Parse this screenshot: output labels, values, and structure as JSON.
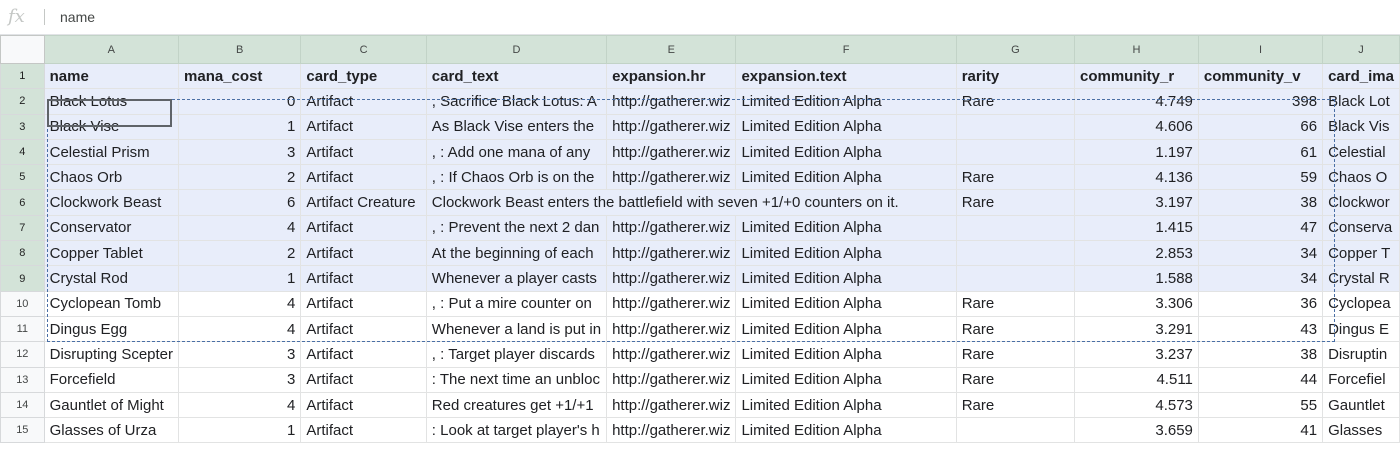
{
  "formula_bar": {
    "icon": "fx",
    "value": "name"
  },
  "columns": [
    "A",
    "B",
    "C",
    "D",
    "E",
    "F",
    "G",
    "H",
    "I",
    "J"
  ],
  "rows": [
    {
      "num": "1",
      "cells": [
        "name",
        "mana_cost",
        "card_type",
        "card_text",
        "expansion.hr",
        "expansion.text",
        "rarity",
        "community_r",
        "community_v",
        "card_ima"
      ]
    },
    {
      "num": "2",
      "cells": [
        "Black Lotus",
        "0",
        "Artifact",
        ", Sacrifice Black Lotus: A",
        "http://gatherer.wiz",
        "Limited Edition Alpha",
        "Rare",
        "4.749",
        "398",
        "Black Lot"
      ]
    },
    {
      "num": "3",
      "cells": [
        "Black Vise",
        "1",
        "Artifact",
        "As Black Vise enters the",
        "http://gatherer.wiz",
        "Limited Edition Alpha",
        "",
        "4.606",
        "66",
        "Black Vis"
      ]
    },
    {
      "num": "4",
      "cells": [
        "Celestial Prism",
        "3",
        "Artifact",
        ", : Add one mana of any",
        "http://gatherer.wiz",
        "Limited Edition Alpha",
        "",
        "1.197",
        "61",
        "Celestial"
      ]
    },
    {
      "num": "5",
      "cells": [
        "Chaos Orb",
        "2",
        "Artifact",
        ", : If Chaos Orb is on the",
        "http://gatherer.wiz",
        "Limited Edition Alpha",
        "Rare",
        "4.136",
        "59",
        "Chaos O"
      ]
    },
    {
      "num": "6",
      "cells": [
        "Clockwork Beast",
        "6",
        "Artifact Creature",
        "Clockwork Beast enters the battlefield with seven +1/+0 counters on it.",
        "",
        "",
        "Rare",
        "3.197",
        "38",
        "Clockwor"
      ]
    },
    {
      "num": "7",
      "cells": [
        "Conservator",
        "4",
        "Artifact",
        ", : Prevent the next 2 dan",
        "http://gatherer.wiz",
        "Limited Edition Alpha",
        "",
        "1.415",
        "47",
        "Conserva"
      ]
    },
    {
      "num": "8",
      "cells": [
        "Copper Tablet",
        "2",
        "Artifact",
        "At the beginning of each",
        "http://gatherer.wiz",
        "Limited Edition Alpha",
        "",
        "2.853",
        "34",
        "Copper T"
      ]
    },
    {
      "num": "9",
      "cells": [
        "Crystal Rod",
        "1",
        "Artifact",
        "Whenever a player casts",
        "http://gatherer.wiz",
        "Limited Edition Alpha",
        "",
        "1.588",
        "34",
        "Crystal R"
      ]
    },
    {
      "num": "10",
      "cells": [
        "Cyclopean Tomb",
        "4",
        "Artifact",
        ", : Put a mire counter on",
        "http://gatherer.wiz",
        "Limited Edition Alpha",
        "Rare",
        "3.306",
        "36",
        "Cyclopea"
      ]
    },
    {
      "num": "11",
      "cells": [
        "Dingus Egg",
        "4",
        "Artifact",
        "Whenever a land is put in",
        "http://gatherer.wiz",
        "Limited Edition Alpha",
        "Rare",
        "3.291",
        "43",
        "Dingus E"
      ]
    },
    {
      "num": "12",
      "cells": [
        "Disrupting Scepter",
        "3",
        "Artifact",
        ", : Target player discards",
        "http://gatherer.wiz",
        "Limited Edition Alpha",
        "Rare",
        "3.237",
        "38",
        "Disruptin"
      ]
    },
    {
      "num": "13",
      "cells": [
        "Forcefield",
        "3",
        "Artifact",
        ": The next time an unbloc",
        "http://gatherer.wiz",
        "Limited Edition Alpha",
        "Rare",
        "4.511",
        "44",
        "Forcefiel"
      ]
    },
    {
      "num": "14",
      "cells": [
        "Gauntlet of Might",
        "4",
        "Artifact",
        "Red creatures get +1/+1",
        "http://gatherer.wiz",
        "Limited Edition Alpha",
        "Rare",
        "4.573",
        "55",
        "Gauntlet"
      ]
    },
    {
      "num": "15",
      "cells": [
        "Glasses of Urza",
        "1",
        "Artifact",
        ": Look at target player's h",
        "http://gatherer.wiz",
        "Limited Edition Alpha",
        "",
        "3.659",
        "41",
        "Glasses"
      ]
    }
  ]
}
